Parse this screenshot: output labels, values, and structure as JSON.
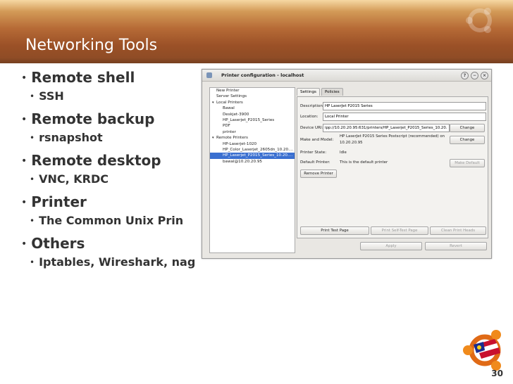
{
  "slide": {
    "title": "Networking Tools",
    "page_number": "30",
    "bullets": [
      {
        "label": "Remote shell",
        "sub": "SSH"
      },
      {
        "label": "Remote backup",
        "sub": "rsnapshot"
      },
      {
        "label": "Remote desktop",
        "sub": "VNC, KRDC"
      },
      {
        "label": "Printer",
        "sub": "The Common Unix Prin"
      },
      {
        "label": "Others",
        "sub": "Iptables, Wireshark, nag"
      }
    ],
    "bullet_char": "•"
  },
  "dialog": {
    "title": "Printer configuration - localhost",
    "tree": [
      {
        "label": "New Printer",
        "level": 0
      },
      {
        "label": "Server Settings",
        "level": 0
      },
      {
        "label": "Local Printers",
        "level": 0,
        "arrow": "▾"
      },
      {
        "label": "Bawal",
        "level": 1
      },
      {
        "label": "Deskjet-3900",
        "level": 1
      },
      {
        "label": "HP_Laserjet_P2015_Series",
        "level": 1
      },
      {
        "label": "PDF",
        "level": 1
      },
      {
        "label": "printer",
        "level": 1
      },
      {
        "label": "Remote Printers",
        "level": 0,
        "arrow": "▾"
      },
      {
        "label": "HP-Laserjet-1020",
        "level": 1
      },
      {
        "label": "HP_Color_Laserjet_2605dn_10.20....",
        "level": 1
      },
      {
        "label": "HP_Laserjet_P2015_Series_10.20....",
        "level": 1,
        "selected": true
      },
      {
        "label": "bawal@10.20.20.95",
        "level": 1
      }
    ],
    "tabs": {
      "settings": "Settings",
      "policies": "Policies"
    },
    "fields": {
      "description_label": "Description:",
      "description_value": "HP LaserJet P2015 Series",
      "location_label": "Location:",
      "location_value": "Local Printer",
      "device_uri_label": "Device URI:",
      "device_uri_value": "ipp://10.20.20.95:631/printers/HP_Laserjet_P2015_Series_10.20.",
      "make_model_label": "Make and Model:",
      "make_model_value_1": "HP LaserJet P2015 Series Postscript (recommended) on",
      "make_model_value_2": "10.20.20.95",
      "state_label": "Printer State:",
      "state_value": "Idle",
      "default_label": "Default Printer:",
      "default_value": "This is the default printer"
    },
    "buttons": {
      "change_uri": "Change",
      "change_model": "Change",
      "make_default": "Make Default",
      "remove_printer": "Remove Printer",
      "print_test_page": "Print Test Page",
      "print_self_test": "Print Self-Test Page",
      "clean_heads": "Clean Print Heads",
      "apply": "Apply",
      "revert": "Revert"
    }
  },
  "colors": {
    "header_top": "#f6d8a3",
    "header_bottom": "#8a4a25",
    "text": "#333333",
    "selection": "#3a6fd0"
  },
  "icons": [
    "ubuntu-logo-icon",
    "malaysia-ubuntu-logo-icon",
    "window-icon",
    "help-icon",
    "minimize-icon",
    "close-icon"
  ]
}
